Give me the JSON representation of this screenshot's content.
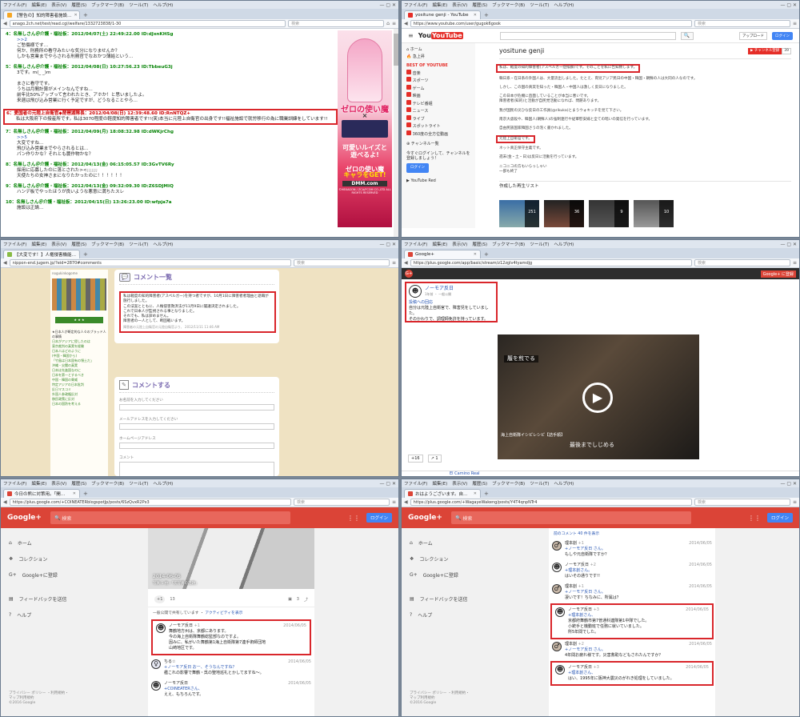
{
  "menu": [
    "ファイル(F)",
    "編集(E)",
    "表示(V)",
    "履歴(S)",
    "ブックマーク(B)",
    "ツール(T)",
    "ヘルプ(H)"
  ],
  "w1": {
    "tab": "【警告の】知的障害者施設…",
    "url": "anago.2ch.net/test/read.cgi/welfare/1332723838/1-30",
    "posts": [
      {
        "h": "4：名無しさん＠介護・福祉板：2012/04/07(土) 22:49:22.00 ID:dJxnKHSg",
        "b": [
          ">>2",
          "ご愁傷様です…",
          "何か、刑務所の看守みたいな気分になりませんか？",
          "しかも営業までやらされる刑務官でなおかつ薄給という…"
        ]
      },
      {
        "h": "5：名無しさん＠介護・福祉板：2012/04/08(日) 10:27:56.23 ID:TbbeuG3j",
        "b": [
          "3です。m(_ _)m",
          "",
          "まさに看守です。",
          "うちは月間計算がメインなんですね…",
          "前年比50%アップって言われたとき、アホか！と思いましたよ。",
          "来週は飛び込み営業に行く予定ですが、どうなることやら…"
        ]
      },
      {
        "h": "6：愛国者の元陸上自衛官◆琵琶湖隊長：2012/04/08(日) 12:39:48.60 ID:RnNTQZ+",
        "b": [
          "私は大阪府下の授産所です。私は3070程度の軽度知的障害者です!!(笑)本当に元陸上自衛官の出身です!!福祉施設で就労移行の為に職業訓練をしています!!"
        ]
      },
      {
        "h": "7：名無しさん＠介護・福祉板：2012/04/09(月) 18:08:32.98 ID:dWKjrChg",
        "b": [
          ">>5",
          "大変ですね…",
          "飛び込み営業までやらされるとは…",
          "パン作りかな？それとも農作物かな？"
        ]
      },
      {
        "h": "8：名無しさん＠介護・福祉板：2012/04/13(金) 06:15:05.57 ID:3GvTV6Ry",
        "b": [
          "採用に応募したのに落とされた><;;;;;;;",
          "天使たちの女神さまになりたかったのに！！！！！！"
        ]
      },
      {
        "h": "9：名無しさん＠介護・福祉板：2012/04/13(金) 09:32:09.30 ID:Z6SDJMIQ",
        "b": [
          "ハンデ板でやったほうが良いような悪意に満ちたスレ"
        ]
      },
      {
        "h": "10：名無しさん＠介護・福祉板：2012/04/15(日) 13:26:23.00 ID:wfpja7a",
        "b": [
          "施設は正論…"
        ]
      }
    ],
    "ad": {
      "t1": "ゼロの使い魔",
      "t2": "可愛いルイズと遊べるよ!",
      "t3": "ゼロの使い魔",
      "t4": "キャラをGET!",
      "t5": "DMM.com",
      "cr": "©HEXAGON / ZCA/FCOM CO.,LTD ALL RIGHTS RESERVED"
    }
  },
  "w2": {
    "tab": "yositune genji - YouTube",
    "url": "https://www.youtube.com/user/gugok6gook",
    "search": "検索",
    "logo": "YouTube",
    "side": [
      "ホーム",
      "急上昇",
      "BEST OF YOUTUBE",
      "音楽",
      "スポーツ",
      "ゲーム",
      "映画",
      "テレビ番組",
      "ニュース",
      "ライブ",
      "スポットライト",
      "360度の全方位動画",
      "チャンネル一覧",
      "今すぐログインして、チャンネルを登録しましょう！",
      "ログイン",
      "YouTube Red"
    ],
    "upload": "アップロード",
    "login": "ログイン",
    "channel": "yositune genji",
    "sub": "チャンネル登録",
    "subn": "39",
    "about": [
      "私は、軽度の知的障害者(アスペルガー症候群)です。そのことを私に告知致します。",
      "韓日系・在日系の外国人は、大量流出しました。たとえ、育児アジア民日の中国・韓国・朝鮮の人は大同の人なのです。",
      "しかし、この国の真実を知った・韓国人・中国人は激しく反日になりました。",
      "この日本が危機に直面していることが本当に悪いです。",
      "障害者者(知的)と活動が自民党活動になれば、問題あります。",
      "我が国民の災ひな反日の工作員(@rikuka)とまうウォキッチを見て下さい。",
      "南京大虐殺や、韓国人(朝鮮人)の強制連行や従軍慰安婦と全ての暗いの発信を行っています。",
      "自由民族国家韓国さうの泡く書かれました。",
      "元陸上自衛官です。",
      "ネット真正保守主義です。",
      "週末(金・土・日)は反日に活動を行っています。",
      "ニコニコの方もいらっしゃい",
      "一部も終了"
    ],
    "playlist": "作成した再生リスト",
    "pl": [
      "251",
      "36",
      "9",
      "10"
    ]
  },
  "w3": {
    "tab": "【大変です！】人権侵害機能…",
    "url": "nippon-end.jugem.jp/?eid=2870#comments",
    "heading": "コメント一覧",
    "comment": [
      "私は軽度の知的障害者(アスペルガー)を持つ者ですが、10月1日に障害者者理由と退職が施行しました。",
      "この法案とともに、人権侵害救済法が11月9日に閣議決定されました。",
      "これで日本人が監視される事となりました。",
      "それでも、私は諦めません。",
      "障害者の一人として、断固戦います。"
    ],
    "sig": "障害者の元陸上自衛官の元陸自衛官より、 2012/11/11 11:46 AM",
    "heading2": "コメントする",
    "labels": [
      "お名前を入力してください",
      "メールアドレスを入力してください",
      "ホームページアドレス",
      "コメント"
    ],
    "side": [
      "★日本人が断定的な人々のブラッド人の事情",
      "日本がアジアに侵したのは",
      "東京裁判の真実を経験",
      "日本人はどのように",
      "(中国・韓国から)",
      "「竹島は日本固有の領土だ」",
      "沖縄・尖閣の真実",
      "日本は先進国なのに",
      "日本を第一とするべき",
      "中国・韓国の脅威",
      "特定アジアの日本批判",
      "反日マスコミ",
      "外国人参政権反対",
      "移民政策に反対",
      "日本の国防を考える"
    ],
    "blogger": "nogukinkogome"
  },
  "w4": {
    "tab": "Google+",
    "url": "https://plus.google.com/app/basic/stream/z12zglv4tyamdjg",
    "gp": "Google+ に登録",
    "name": "ノーモア反日",
    "meta": "1年前 ・ 一般公開",
    "link": "投稿への回応",
    "text": [
      "自分は元陸上自衛官で、障害児をしていました。",
      "そのかわりで、調理師免許を持っています。"
    ],
    "video": "履を煎でる",
    "sub": "海上自衛隊イシピレシピ【詰手順】",
    "sub2": "最後までしじめる",
    "plus": "+16",
    "share": "1",
    "next": "El Camino Real"
  },
  "w5": {
    "tab": "今日の熊に対策用。「開…",
    "url": "https://plus.google.com/+COINEATERblogspotJp/posts/6SzQvxR2Px3",
    "logo": "Google+",
    "search": "検索",
    "login": "ログイン",
    "side": [
      "ホーム",
      "コレクション",
      "Google+に登録",
      "フィードバックを送信",
      "ヘルプ"
    ],
    "foot": [
      "プライバシー ポリシー ・利用規約・",
      "マップ利用規約",
      "©2016 Google"
    ],
    "date": "2014-06-05",
    "cap": "写真 5 枚・「次写真の話題」",
    "plus": "+1",
    "pn": "13",
    "cnt": "3",
    "shared": "一般公開で共有しています ・",
    "act": "アクティビティを表示",
    "c": [
      {
        "n": "ノーモア反日",
        "p": "+1",
        "d": "2014/06/05",
        "t": [
          "舞鶴地方州は、京都にあります。",
          "今の海上自衛隊舞鶴総監部なのですよ。",
          "因みに、私がいた舞鶴第1海上自衛隊第7連手術師団地",
          "山崎地区です。"
        ]
      },
      {
        "n": "ちる☆",
        "p": "",
        "d": "2014/06/05",
        "t": [
          "+ノーモア反日 おー、そうなんですね？",
          "艦これの影響で舞鶴・呉の聖地巡礼とかしてますね～。"
        ]
      },
      {
        "n": "ノーモア反日",
        "p": "",
        "d": "2014/06/05",
        "t": [
          "+COINEATERさん、",
          "ええ、もちろんです。"
        ]
      }
    ]
  },
  "w6": {
    "tab": "おはようございます。自…",
    "url": "https://plus.google.com/+WagayeWakeng/posts/Y4T4qnpNTr4",
    "logo": "Google+",
    "search": "検索",
    "login": "ログイン",
    "more": "前のコメント 40 件を表示",
    "c": [
      {
        "n": "理本創",
        "p": "+1",
        "d": "2014/06/05",
        "t": [
          "+ノーモア反日 さん。",
          "もしや元自衛隊ですか？"
        ],
        "h": false
      },
      {
        "n": "ノーモア反日",
        "p": "+2",
        "d": "2014/06/05",
        "t": [
          "+理本創さん。",
          "はいその通りです!!"
        ],
        "h": false
      },
      {
        "n": "理本創",
        "p": "+1",
        "d": "2014/06/05",
        "t": [
          "+ノーモア反日 さん。",
          "凄いです！ちなみに、所属は？"
        ],
        "h": false
      },
      {
        "n": "ノーモア反日",
        "p": "+3",
        "d": "2014/06/05",
        "t": [
          "+理本創さん、",
          "京都府舞鶴市第7普通科連隊第1中隊でした。",
          "小銃手と機動班で任務に就いていました。",
          "所5年間でした。"
        ],
        "h": true
      },
      {
        "n": "理本創",
        "p": "+2",
        "d": "2014/06/05",
        "t": [
          "+ノーモア反日 さん。",
          "4年間お疲れ様です。災害救助などもされたんですか？"
        ],
        "h": false
      },
      {
        "n": "ノーモア反日",
        "p": "+3",
        "d": "2014/06/05",
        "t": [
          "+理本創さん、",
          "はい、1995年に阪神大震災のがれき処理をしていました。"
        ],
        "h": true
      }
    ]
  }
}
